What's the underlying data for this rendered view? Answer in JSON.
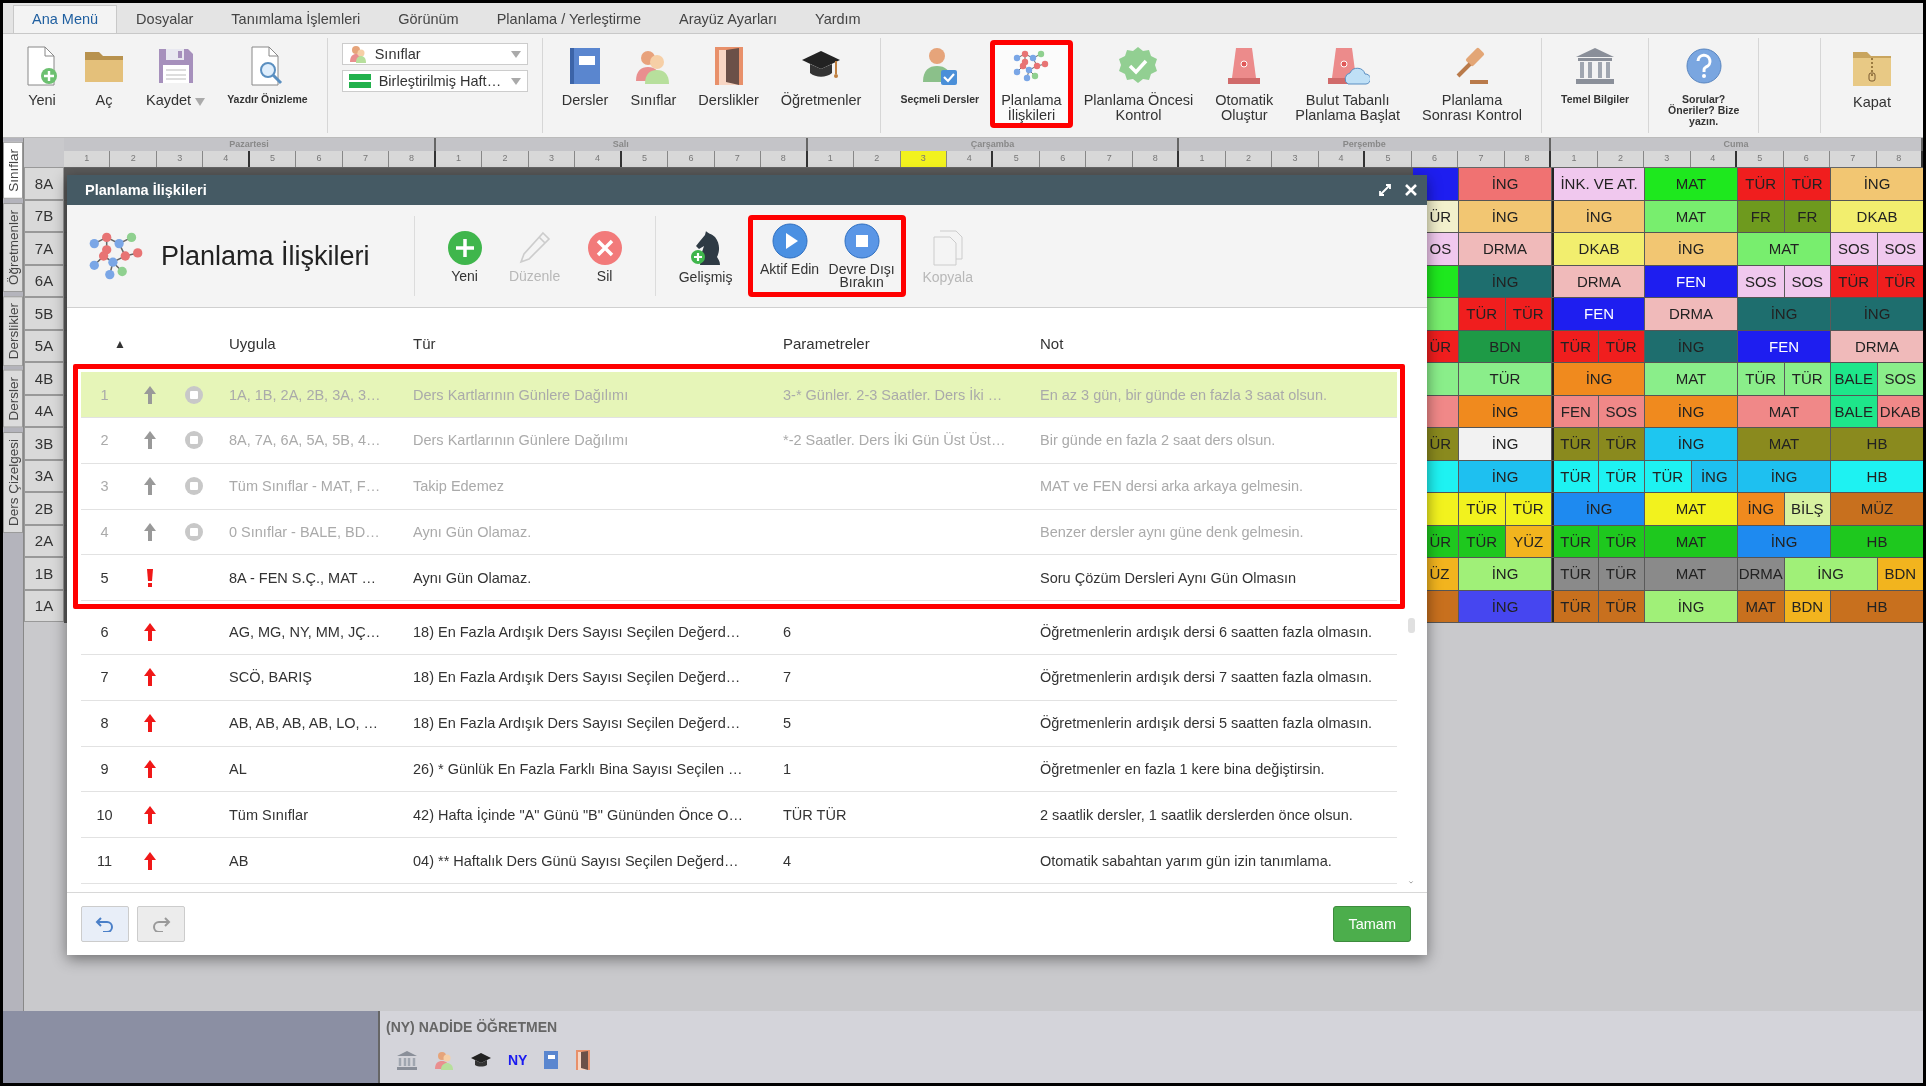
{
  "menu_tabs": [
    {
      "label": "Ana Menü",
      "selected": true
    },
    {
      "label": "Dosyalar",
      "selected": false
    },
    {
      "label": "Tanımlama İşlemleri",
      "selected": false
    },
    {
      "label": "Görünüm",
      "selected": false
    },
    {
      "label": "Planlama / Yerleştirme",
      "selected": false
    },
    {
      "label": "Arayüz Ayarları",
      "selected": false
    },
    {
      "label": "Yardım",
      "selected": false
    }
  ],
  "ribbon": {
    "groups": [
      {
        "kind": "buttons",
        "items": [
          {
            "label": "Yeni",
            "kind": "large",
            "highlighted": false
          },
          {
            "label": "Aç",
            "kind": "large",
            "highlighted": false
          },
          {
            "label": "Kaydet",
            "kind": "dropdown",
            "highlighted": false
          },
          {
            "label": "Yazdır Önizleme",
            "kind": "small",
            "highlighted": false
          }
        ]
      },
      {
        "kind": "selectors",
        "items": [
          {
            "value": "Sınıflar"
          },
          {
            "value": "Birleştirilmiş Haft…"
          }
        ]
      },
      {
        "kind": "buttons",
        "items": [
          {
            "label": "Dersler",
            "kind": "large",
            "highlighted": false
          },
          {
            "label": "Sınıflar",
            "kind": "large",
            "highlighted": false
          },
          {
            "label": "Derslikler",
            "kind": "large",
            "highlighted": false
          },
          {
            "label": "Öğretmenler",
            "kind": "large",
            "highlighted": false
          }
        ]
      },
      {
        "kind": "buttons",
        "items": [
          {
            "label": "Seçmeli Dersler",
            "kind": "small",
            "highlighted": false
          },
          {
            "label": "Planlama\nİlişkileri",
            "kind": "large",
            "highlighted": true
          },
          {
            "label": "Planlama Öncesi\nKontrol",
            "kind": "large",
            "highlighted": false
          },
          {
            "label": "Otomatik\nOluştur",
            "kind": "large",
            "highlighted": false
          },
          {
            "label": "Bulut Tabanlı\nPlanlama Başlat",
            "kind": "large",
            "highlighted": false
          },
          {
            "label": "Planlama\nSonrası Kontrol",
            "kind": "large",
            "highlighted": false
          }
        ]
      },
      {
        "kind": "buttons",
        "items": [
          {
            "label": "Temel Bilgiler",
            "kind": "small",
            "highlighted": false
          }
        ]
      },
      {
        "kind": "buttons",
        "items": [
          {
            "label": "Sorular?\nÖneriler? Bize\nyazın.",
            "kind": "small",
            "highlighted": false
          }
        ]
      },
      {
        "kind": "buttons",
        "items": [
          {
            "label": "Kapat",
            "kind": "large",
            "highlighted": false
          }
        ]
      }
    ]
  },
  "sidebar_tabs": [
    {
      "label": "Sınıflar",
      "selected": true
    },
    {
      "label": "Öğretmenler",
      "selected": false
    },
    {
      "label": "Derslikler",
      "selected": false
    },
    {
      "label": "Dersler",
      "selected": false
    },
    {
      "label": "Ders Çizelgesi",
      "selected": false
    }
  ],
  "timetable": {
    "days": [
      {
        "name": "Pazartesi",
        "periods": [
          {
            "label": "1",
            "selected": false
          },
          {
            "label": "2",
            "selected": false
          },
          {
            "label": "3",
            "selected": false
          },
          {
            "label": "4",
            "selected": false
          },
          {
            "label": "5",
            "selected": false
          },
          {
            "label": "6",
            "selected": false
          },
          {
            "label": "7",
            "selected": false
          },
          {
            "label": "8",
            "selected": false
          }
        ]
      },
      {
        "name": "Salı",
        "periods": [
          {
            "label": "1",
            "selected": false
          },
          {
            "label": "2",
            "selected": false
          },
          {
            "label": "3",
            "selected": false
          },
          {
            "label": "4",
            "selected": false
          },
          {
            "label": "5",
            "selected": false
          },
          {
            "label": "6",
            "selected": false
          },
          {
            "label": "7",
            "selected": false
          },
          {
            "label": "8",
            "selected": false
          }
        ]
      },
      {
        "name": "Çarşamba",
        "periods": [
          {
            "label": "1",
            "selected": false
          },
          {
            "label": "2",
            "selected": false
          },
          {
            "label": "3",
            "selected": true
          },
          {
            "label": "4",
            "selected": false
          },
          {
            "label": "5",
            "selected": false
          },
          {
            "label": "6",
            "selected": false
          },
          {
            "label": "7",
            "selected": false
          },
          {
            "label": "8",
            "selected": false
          }
        ]
      },
      {
        "name": "Perşembe",
        "periods": [
          {
            "label": "1",
            "selected": false
          },
          {
            "label": "2",
            "selected": false
          },
          {
            "label": "3",
            "selected": false
          },
          {
            "label": "4",
            "selected": false
          },
          {
            "label": "5",
            "selected": false
          },
          {
            "label": "6",
            "selected": false
          },
          {
            "label": "7",
            "selected": false
          },
          {
            "label": "8",
            "selected": false
          }
        ]
      },
      {
        "name": "Cuma",
        "periods": [
          {
            "label": "1",
            "selected": false
          },
          {
            "label": "2",
            "selected": false
          },
          {
            "label": "3",
            "selected": false
          },
          {
            "label": "4",
            "selected": false
          },
          {
            "label": "5",
            "selected": false
          },
          {
            "label": "6",
            "selected": false
          },
          {
            "label": "7",
            "selected": false
          },
          {
            "label": "8",
            "selected": false
          }
        ]
      }
    ],
    "rows": [
      {
        "class": "8A",
        "cells": [
          {
            "color": "#1e1ef0",
            "double": false
          },
          {
            "lesson": "İNG",
            "color": "#f07272",
            "double": true
          },
          {
            "lesson": "İNK. VE AT.",
            "color": "#f0c8ee",
            "double": true
          },
          {
            "lesson": "MAT",
            "color": "#1ee81e",
            "double": true
          },
          {
            "lesson": "TÜR",
            "color": "#f01e1e",
            "double": false
          },
          {
            "lesson": "TÜR",
            "color": "#f01e1e",
            "double": false
          },
          {
            "lesson": "İNG",
            "color": "#f2c672",
            "double": true
          }
        ]
      },
      {
        "class": "7B",
        "cells": [
          {
            "lesson": "ÜR",
            "color": "#f2f0cc",
            "double": false
          },
          {
            "lesson": "İNG",
            "color": "#f2c672",
            "double": true
          },
          {
            "lesson": "İNG",
            "color": "#f2c672",
            "double": true
          },
          {
            "lesson": "MAT",
            "color": "#78ee6e",
            "double": true
          },
          {
            "lesson": "FR",
            "color": "#6e9a1e",
            "double": false
          },
          {
            "lesson": "FR",
            "color": "#6e9a1e",
            "double": false
          },
          {
            "lesson": "DKAB",
            "color": "#f2ee6e",
            "double": true
          }
        ]
      },
      {
        "class": "7A",
        "cells": [
          {
            "lesson": "OS",
            "color": "#f0c8ee",
            "double": false
          },
          {
            "lesson": "DRMA",
            "color": "#f0baba",
            "double": true
          },
          {
            "lesson": "DKAB",
            "color": "#f2ee6e",
            "double": true
          },
          {
            "lesson": "İNG",
            "color": "#f2c672",
            "double": true
          },
          {
            "lesson": "MAT",
            "color": "#78ee6e",
            "double": true
          },
          {
            "lesson": "SOS",
            "color": "#f0c8ee",
            "double": false
          },
          {
            "lesson": "SOS",
            "color": "#f0c8ee",
            "double": false
          }
        ]
      },
      {
        "class": "6A",
        "cells": [
          {
            "color": "#1ee81e",
            "double": false
          },
          {
            "lesson": "İNG",
            "color": "#1e6e6e",
            "double": true
          },
          {
            "lesson": "DRMA",
            "color": "#f0baba",
            "double": true
          },
          {
            "lesson": "FEN",
            "color": "#1e1ef0",
            "double": true
          },
          {
            "lesson": "SOS",
            "color": "#f0c8ee",
            "double": false
          },
          {
            "lesson": "SOS",
            "color": "#f0c8ee",
            "double": false
          },
          {
            "lesson": "TÜR",
            "color": "#f01e1e",
            "double": false
          },
          {
            "lesson": "TÜR",
            "color": "#f01e1e",
            "double": false
          }
        ]
      },
      {
        "class": "5B",
        "cells": [
          {
            "color": "#78ee6e",
            "double": false
          },
          {
            "lesson": "TÜR",
            "color": "#f01e1e",
            "double": false
          },
          {
            "lesson": "TÜR",
            "color": "#f01e1e",
            "double": false
          },
          {
            "lesson": "FEN",
            "color": "#1e1ef0",
            "double": true
          },
          {
            "lesson": "DRMA",
            "color": "#f0baba",
            "double": true
          },
          {
            "lesson": "İNG",
            "color": "#1e6e6e",
            "double": true
          },
          {
            "lesson": "İNG",
            "color": "#1e6e6e",
            "double": true
          }
        ]
      },
      {
        "class": "5A",
        "cells": [
          {
            "lesson": "ÜR",
            "color": "#f01e1e",
            "double": false
          },
          {
            "lesson": "BDN",
            "color": "#1e9a46",
            "double": true
          },
          {
            "lesson": "TÜR",
            "color": "#f01e1e",
            "double": false
          },
          {
            "lesson": "TÜR",
            "color": "#f01e1e",
            "double": false
          },
          {
            "lesson": "İNG",
            "color": "#1e6e6e",
            "double": true
          },
          {
            "lesson": "FEN",
            "color": "#1e1ef0",
            "double": true
          },
          {
            "lesson": "DRMA",
            "color": "#f0baba",
            "double": true
          }
        ]
      },
      {
        "class": "4B",
        "cells": [
          {
            "color": "#8aee8a",
            "double": false
          },
          {
            "lesson": "TÜR",
            "color": "#8aee8a",
            "double": true
          },
          {
            "lesson": "İNG",
            "color": "#f08a1e",
            "double": true
          },
          {
            "lesson": "MAT",
            "color": "#8aee8a",
            "double": true
          },
          {
            "lesson": "TÜR",
            "color": "#8aee8a",
            "double": false
          },
          {
            "lesson": "TÜR",
            "color": "#8aee8a",
            "double": false
          },
          {
            "lesson": "BALE",
            "color": "#1ee68a",
            "double": false
          },
          {
            "lesson": "SOS",
            "color": "#8aee8a",
            "double": false
          }
        ]
      },
      {
        "class": "4A",
        "cells": [
          {
            "color": "#f08888",
            "double": false
          },
          {
            "lesson": "İNG",
            "color": "#f08a1e",
            "double": true
          },
          {
            "lesson": "FEN",
            "color": "#f08888",
            "double": false
          },
          {
            "lesson": "SOS",
            "color": "#f08888",
            "double": false
          },
          {
            "lesson": "İNG",
            "color": "#f08a1e",
            "double": true
          },
          {
            "lesson": "MAT",
            "color": "#f08888",
            "double": true
          },
          {
            "lesson": "BALE",
            "color": "#1ee68a",
            "double": false
          },
          {
            "lesson": "DKAB",
            "color": "#f08888",
            "double": false
          }
        ]
      },
      {
        "class": "3B",
        "cells": [
          {
            "lesson": "ÜR",
            "color": "#8a8a1e",
            "double": false
          },
          {
            "lesson": "İNG",
            "color": "#f2f2f2",
            "double": true
          },
          {
            "lesson": "TÜR",
            "color": "#8a8a1e",
            "double": false
          },
          {
            "lesson": "TÜR",
            "color": "#8a8a1e",
            "double": false
          },
          {
            "lesson": "İNG",
            "color": "#1ec6f0",
            "double": true
          },
          {
            "lesson": "MAT",
            "color": "#8a8a1e",
            "double": true
          },
          {
            "lesson": "HB",
            "color": "#8a8a1e",
            "double": true
          }
        ]
      },
      {
        "class": "3A",
        "cells": [
          {
            "color": "#1ef2f2",
            "double": false
          },
          {
            "lesson": "İNG",
            "color": "#1ec0f0",
            "double": true
          },
          {
            "lesson": "TÜR",
            "color": "#1ef2f2",
            "double": false
          },
          {
            "lesson": "TÜR",
            "color": "#1ef2f2",
            "double": false
          },
          {
            "lesson": "TÜR",
            "color": "#1ef2f2",
            "double": false
          },
          {
            "lesson": "İNG",
            "color": "#1ec0f0",
            "double": false
          },
          {
            "lesson": "İNG",
            "color": "#1ec0f0",
            "double": true
          },
          {
            "lesson": "HB",
            "color": "#1ef2f2",
            "double": true
          }
        ]
      },
      {
        "class": "2B",
        "cells": [
          {
            "color": "#f2f21e",
            "double": false
          },
          {
            "lesson": "TÜR",
            "color": "#f2f21e",
            "double": false
          },
          {
            "lesson": "TÜR",
            "color": "#f2f21e",
            "double": false
          },
          {
            "lesson": "İNG",
            "color": "#1e8af0",
            "double": true
          },
          {
            "lesson": "MAT",
            "color": "#f2f21e",
            "double": true
          },
          {
            "lesson": "İNG",
            "color": "#f08a1e",
            "double": false
          },
          {
            "lesson": "BİLŞ",
            "color": "#d8f2a0",
            "double": false
          },
          {
            "lesson": "MÜZ",
            "color": "#c8701e",
            "double": true
          }
        ]
      },
      {
        "class": "2A",
        "cells": [
          {
            "lesson": "ÜR",
            "color": "#1ec81e",
            "double": false
          },
          {
            "lesson": "TÜR",
            "color": "#1ec81e",
            "double": false
          },
          {
            "lesson": "YÜZ",
            "color": "#f2b41e",
            "double": false
          },
          {
            "lesson": "TÜR",
            "color": "#1ec81e",
            "double": false
          },
          {
            "lesson": "TÜR",
            "color": "#1ec81e",
            "double": false
          },
          {
            "lesson": "MAT",
            "color": "#1ec81e",
            "double": true
          },
          {
            "lesson": "İNG",
            "color": "#1e8af0",
            "double": true
          },
          {
            "lesson": "HB",
            "color": "#1ec81e",
            "double": true
          }
        ]
      },
      {
        "class": "1B",
        "cells": [
          {
            "lesson": "ÜZ",
            "color": "#f2b41e",
            "double": false
          },
          {
            "lesson": "İNG",
            "color": "#a0f078",
            "double": true
          },
          {
            "lesson": "TÜR",
            "color": "#8a8a8a",
            "double": false
          },
          {
            "lesson": "TÜR",
            "color": "#8a8a8a",
            "double": false
          },
          {
            "lesson": "MAT",
            "color": "#8a8a8a",
            "double": true
          },
          {
            "lesson": "DRMA",
            "color": "#8a8a8a",
            "double": false
          },
          {
            "lesson": "İNG",
            "color": "#a0f078",
            "double": true
          },
          {
            "lesson": "BDN",
            "color": "#f2b41e",
            "double": false
          }
        ]
      },
      {
        "class": "1A",
        "cells": [
          {
            "color": "#c8701e",
            "double": false
          },
          {
            "lesson": "İNG",
            "color": "#4646f0",
            "double": true
          },
          {
            "lesson": "TÜR",
            "color": "#c8701e",
            "double": false
          },
          {
            "lesson": "TÜR",
            "color": "#c8701e",
            "double": false
          },
          {
            "lesson": "İNG",
            "color": "#a0f078",
            "double": true
          },
          {
            "lesson": "MAT",
            "color": "#c8701e",
            "double": false
          },
          {
            "lesson": "BDN",
            "color": "#f2b41e",
            "double": false
          },
          {
            "lesson": "HB",
            "color": "#c8701e",
            "double": true
          }
        ]
      }
    ]
  },
  "dialog": {
    "title": "Planlama İlişkileri",
    "heading": "Planlama İlişkileri",
    "toolbar": [
      {
        "kind": "plain",
        "buttons": [
          {
            "label": "Yeni",
            "disabled": false
          },
          {
            "label": "Düzenle",
            "disabled": true
          },
          {
            "label": "Sil",
            "disabled": false
          }
        ]
      },
      {
        "kind": "plain",
        "buttons": [
          {
            "label": "Gelişmiş",
            "disabled": false
          }
        ]
      },
      {
        "kind": "highlighted",
        "buttons": [
          {
            "label": "Aktif Edin",
            "disabled": false
          },
          {
            "label": "Devre Dışı\nBırakın",
            "disabled": false
          }
        ]
      },
      {
        "kind": "plain",
        "buttons": [
          {
            "label": "Kopyala",
            "disabled": true
          }
        ]
      }
    ],
    "columns": [
      "▲",
      "Uygula",
      "Tür",
      "Parametreler",
      "Not"
    ],
    "row_groups": [
      {
        "kind": "highlighted",
        "rows": [
          {
            "number": "1",
            "kind": "inactive",
            "selected": true,
            "apply": "1A, 1B, 2A, 2B, 3A, 3…",
            "type": "Ders Kartlarının Günlere Dağılımı",
            "parameters": "3-* Günler. 2-3 Saatler. Ders İki …",
            "note": "En az 3 gün, bir günde en fazla 3 saat olsun."
          },
          {
            "number": "2",
            "kind": "inactive",
            "selected": false,
            "apply": "8A, 7A, 6A, 5A, 5B, 4…",
            "type": "Ders Kartlarının Günlere Dağılımı",
            "parameters": "*-2 Saatler. Ders İki Gün Üst Üst…",
            "note": "Bir günde en fazla 2 saat ders olsun."
          },
          {
            "number": "3",
            "kind": "inactive",
            "selected": false,
            "apply": "Tüm Sınıflar - MAT, F…",
            "type": "Takip Edemez",
            "note": "MAT ve FEN dersi arka arkaya gelmesin."
          },
          {
            "number": "4",
            "kind": "inactive",
            "selected": false,
            "apply": "0 Sınıflar - BALE, BD…",
            "type": "Aynı Gün Olamaz.",
            "note": "Benzer dersler aynı güne denk gelmesin."
          },
          {
            "number": "5",
            "kind": "warning",
            "selected": false,
            "apply": "8A - FEN S.Ç., MAT …",
            "type": "Aynı Gün Olamaz.",
            "note": "Soru Çözüm Dersleri Aynı Gün Olmasın"
          }
        ]
      },
      {
        "kind": "plain",
        "rows": [
          {
            "number": "6",
            "kind": "active",
            "selected": false,
            "apply": "AG, MG, NY, MM, JÇ…",
            "type": "18) En Fazla Ardışık Ders Sayısı Seçilen Değerd…",
            "parameters": "6",
            "note": "Öğretmenlerin ardışık dersi 6 saatten fazla olmasın."
          },
          {
            "number": "7",
            "kind": "active",
            "selected": false,
            "apply": "SCÖ, BARIŞ",
            "type": "18) En Fazla Ardışık Ders Sayısı Seçilen Değerd…",
            "parameters": "7",
            "note": "Öğretmenlerin ardışık dersi 7 saatten fazla olmasın."
          },
          {
            "number": "8",
            "kind": "active",
            "selected": false,
            "apply": "AB, AB, AB, AB, LO, …",
            "type": "18) En Fazla Ardışık Ders Sayısı Seçilen Değerd…",
            "parameters": "5",
            "note": "Öğretmenlerin ardışık dersi 5 saatten fazla olmasın."
          },
          {
            "number": "9",
            "kind": "active",
            "selected": false,
            "apply": "AL",
            "type": "26) * Günlük En Fazla Farklı Bina Sayısı Seçilen …",
            "parameters": "1",
            "note": "Öğretmenler en fazla 1 kere bina değiştirsin."
          },
          {
            "number": "10",
            "kind": "active",
            "selected": false,
            "apply": "Tüm Sınıflar",
            "type": "42) Hafta İçinde \"A\" Günü \"B\" Gününden Önce O…",
            "parameters": "TÜR TÜR",
            "note": "2 saatlik dersler, 1 saatlik derslerden önce olsun."
          },
          {
            "number": "11",
            "kind": "active",
            "selected": false,
            "apply": "AB",
            "type": "04) ** Haftalık Ders Günü Sayısı Seçilen Değerd…",
            "parameters": "4",
            "note": "Otomatik sabahtan yarım gün izin tanımlama."
          }
        ]
      }
    ],
    "ok_button": "Tamam"
  },
  "status_bar": {
    "title": "(NY) NADİDE ÖĞRETMEN",
    "code": "NY"
  }
}
